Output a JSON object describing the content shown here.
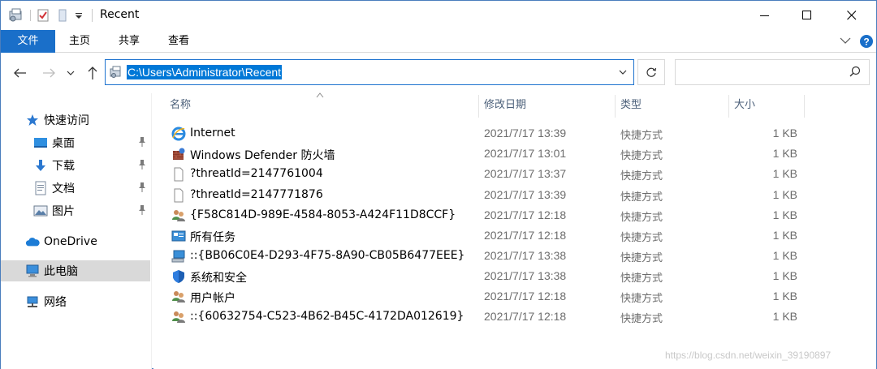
{
  "window": {
    "title": "Recent"
  },
  "ribbon": {
    "tabs": [
      {
        "label": "文件"
      },
      {
        "label": "主页"
      },
      {
        "label": "共享"
      },
      {
        "label": "查看"
      }
    ]
  },
  "address": {
    "path": "C:\\Users\\Administrator\\Recent",
    "search_placeholder": ""
  },
  "nav": {
    "items": [
      {
        "label": "快速访问",
        "icon": "star-icon"
      },
      {
        "label": "桌面",
        "icon": "desktop-icon",
        "pinned": true
      },
      {
        "label": "下载",
        "icon": "download-icon",
        "pinned": true
      },
      {
        "label": "文档",
        "icon": "document-icon",
        "pinned": true
      },
      {
        "label": "图片",
        "icon": "picture-icon",
        "pinned": true
      },
      {
        "label": "OneDrive",
        "icon": "cloud-icon"
      },
      {
        "label": "此电脑",
        "icon": "computer-icon",
        "selected": true
      },
      {
        "label": "网络",
        "icon": "network-icon"
      }
    ]
  },
  "list": {
    "headers": {
      "name": "名称",
      "date": "修改日期",
      "type": "类型",
      "size": "大小"
    },
    "rows": [
      {
        "name": "Internet",
        "date": "2021/7/17 13:39",
        "type": "快捷方式",
        "size": "1 KB",
        "icon": "ie-icon"
      },
      {
        "name": "Windows Defender 防火墙",
        "date": "2021/7/17 13:01",
        "type": "快捷方式",
        "size": "1 KB",
        "icon": "firewall-icon"
      },
      {
        "name": "?threatId=2147761004",
        "date": "2021/7/17 13:37",
        "type": "快捷方式",
        "size": "1 KB",
        "icon": "blank-file-icon"
      },
      {
        "name": "?threatId=2147771876",
        "date": "2021/7/17 13:39",
        "type": "快捷方式",
        "size": "1 KB",
        "icon": "blank-file-icon"
      },
      {
        "name": "{F58C814D-989E-4584-8053-A424F11D8CCF}",
        "date": "2021/7/17 12:18",
        "type": "快捷方式",
        "size": "1 KB",
        "icon": "users-icon"
      },
      {
        "name": "所有任务",
        "date": "2021/7/17 12:18",
        "type": "快捷方式",
        "size": "1 KB",
        "icon": "control-panel-icon"
      },
      {
        "name": "::{BB06C0E4-D293-4F75-8A90-CB05B6477EEE}",
        "date": "2021/7/17 13:38",
        "type": "快捷方式",
        "size": "1 KB",
        "icon": "system-icon"
      },
      {
        "name": "系统和安全",
        "date": "2021/7/17 13:38",
        "type": "快捷方式",
        "size": "1 KB",
        "icon": "shield-icon"
      },
      {
        "name": "用户帐户",
        "date": "2021/7/17 12:18",
        "type": "快捷方式",
        "size": "1 KB",
        "icon": "users-icon"
      },
      {
        "name": "::{60632754-C523-4B62-B45C-4172DA012619}",
        "date": "2021/7/17 12:18",
        "type": "快捷方式",
        "size": "1 KB",
        "icon": "users-icon"
      }
    ]
  },
  "watermark": "https://blog.csdn.net/weixin_39190897",
  "colors": {
    "accent": "#1a6fc9",
    "selection": "#0078d7",
    "nav_selected": "#d9d9d9"
  }
}
